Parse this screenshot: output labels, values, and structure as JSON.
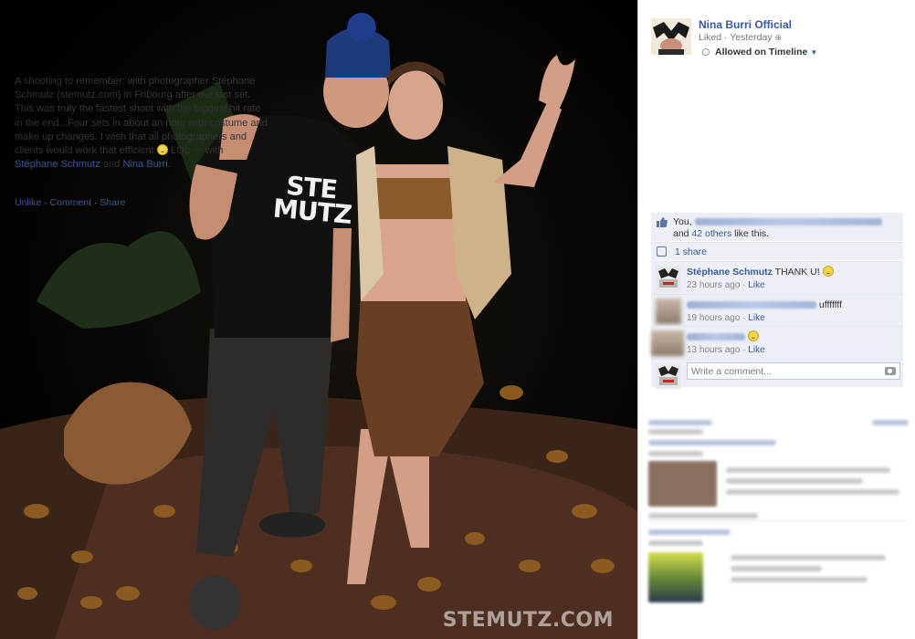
{
  "photo": {
    "watermark": "STEMUTZ.COM",
    "shirt_text": [
      "STE",
      "MUTZ"
    ]
  },
  "post": {
    "page_name": "Nina Burri Official",
    "meta": "Liked · Yesterday",
    "timeline_label": "Allowed on Timeline",
    "caption_main": "A shooting to remember: with photographer Stéphane Schmutz (stemutz.com) in Fribourg after our last set. This was truly the fastest shoot with the biggest hit rate in the end...Four sets in about an hour with costume and make up changes. I wish that all photographers and clients would work that efficient",
    "caption_lol": " LOL — with ",
    "tag1": "Stéphane Schmutz",
    "tag_and": " and ",
    "tag2": "Nina Burri",
    "tag_end": "."
  },
  "actions": {
    "unlike": "Unlike",
    "comment": "Comment",
    "share": "Share",
    "sep": " · "
  },
  "likes": {
    "you": "You,",
    "and": "and ",
    "others": "42 others",
    "tail": " like this.",
    "shares": "1 share"
  },
  "comments": [
    {
      "author": "Stéphane Schmutz",
      "text": "THANK U!",
      "time": "23 hours ago",
      "like": "Like"
    },
    {
      "author": "",
      "text": "ufffffff",
      "time": "19 hours ago",
      "like": "Like"
    },
    {
      "author": "",
      "text": "",
      "time": "13 hours ago",
      "like": "Like"
    }
  ],
  "write_comment_placeholder": "Write a comment...",
  "colors": {
    "link": "#3b5998",
    "ufi_background": "#eceff5",
    "photo_background": "#000000"
  }
}
